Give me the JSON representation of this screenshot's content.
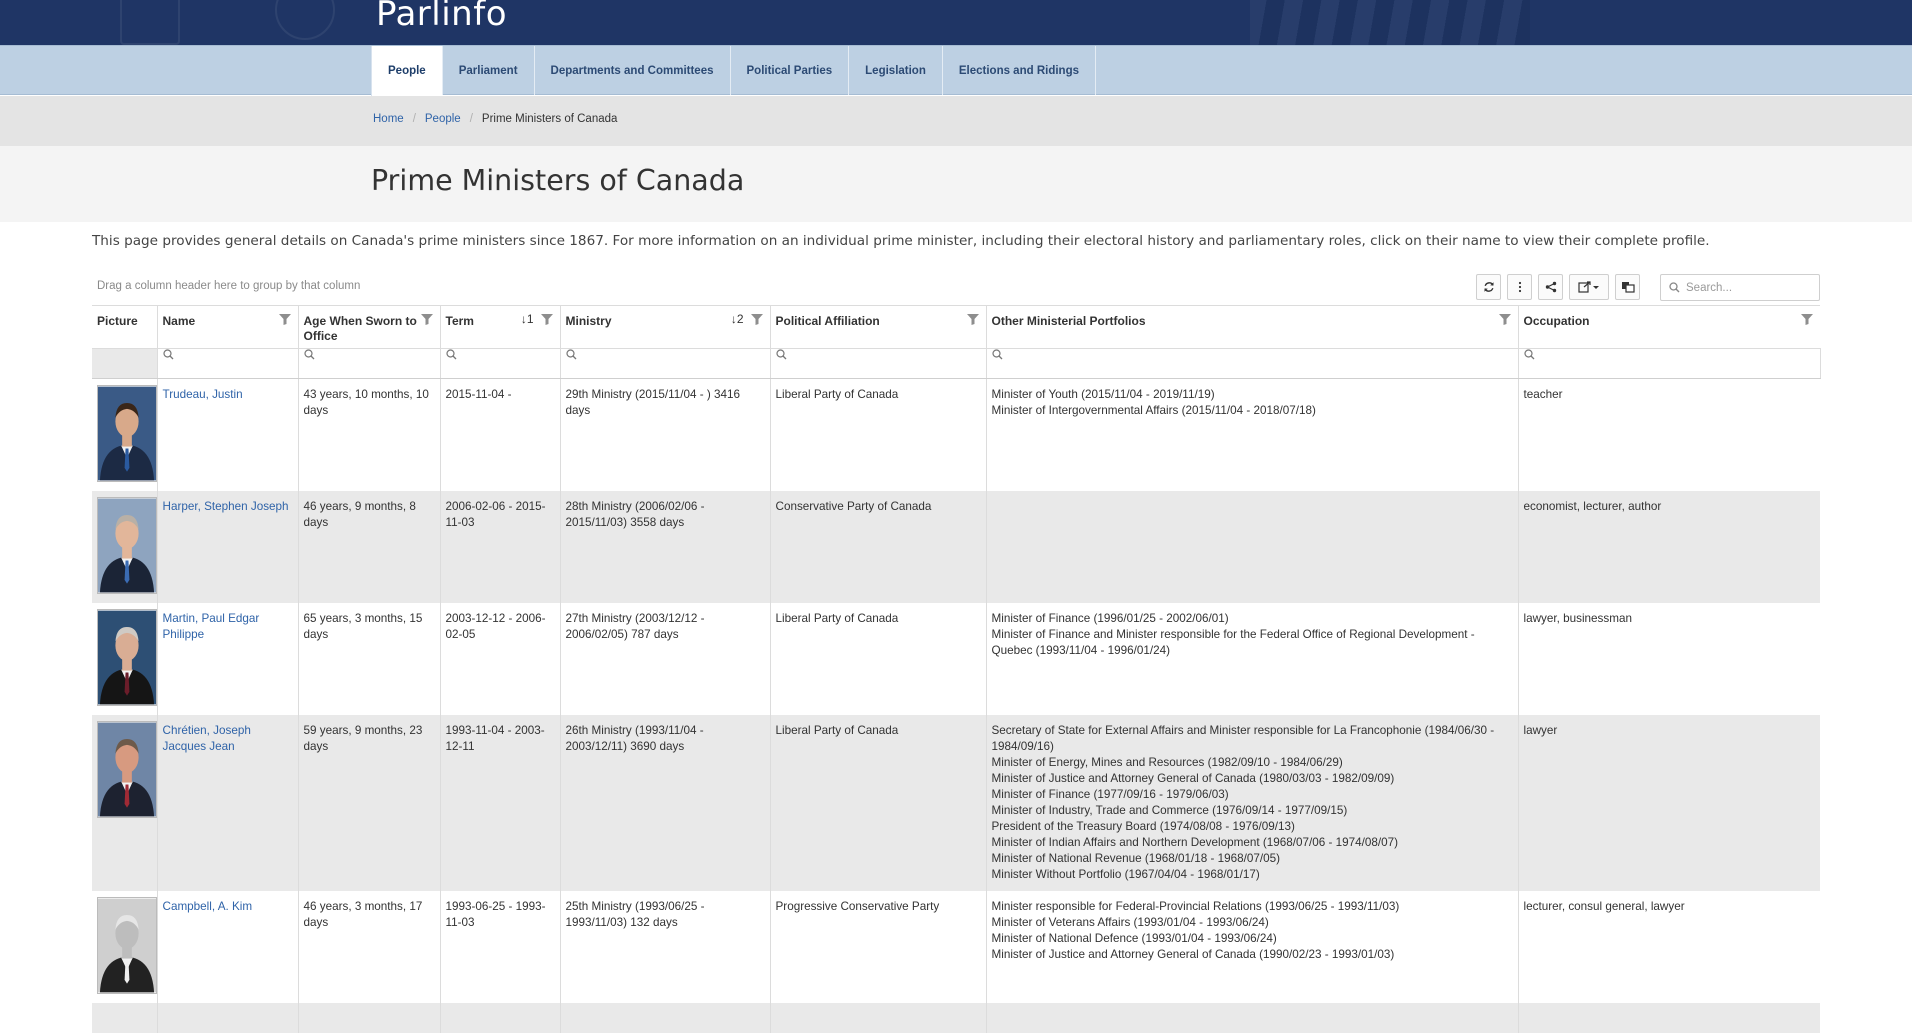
{
  "site": {
    "title": "Parlinfo"
  },
  "nav": {
    "tabs": [
      {
        "label": "People",
        "active": true
      },
      {
        "label": "Parliament"
      },
      {
        "label": "Departments and Committees"
      },
      {
        "label": "Political Parties"
      },
      {
        "label": "Legislation"
      },
      {
        "label": "Elections and Ridings"
      }
    ]
  },
  "breadcrumb": {
    "home": "Home",
    "people": "People",
    "current": "Prime Ministers of Canada"
  },
  "page": {
    "title": "Prime Ministers of Canada",
    "intro": "This page provides general details on Canada's prime ministers since 1867. For more information on an individual prime minister, including their electoral history and parliamentary roles, click on their name to view their complete profile."
  },
  "grid": {
    "group_hint": "Drag a column header here to group by that column",
    "search_placeholder": "Search...",
    "toolbar_icons": [
      "refresh-icon",
      "column-chooser-icon",
      "share-icon",
      "export-icon",
      "language-icon"
    ],
    "columns": [
      {
        "key": "picture",
        "label": "Picture"
      },
      {
        "key": "name",
        "label": "Name"
      },
      {
        "key": "age",
        "label": "Age When Sworn to Office"
      },
      {
        "key": "term",
        "label": "Term",
        "sort": "1"
      },
      {
        "key": "ministry",
        "label": "Ministry",
        "sort": "2"
      },
      {
        "key": "party",
        "label": "Political Affiliation"
      },
      {
        "key": "portfolios",
        "label": "Other Ministerial Portfolios"
      },
      {
        "key": "occupation",
        "label": "Occupation"
      }
    ],
    "rows": [
      {
        "name": "Trudeau, Justin",
        "age": "43 years, 10 months, 10 days",
        "term": "2015-11-04 -",
        "ministry": "29th Ministry (2015/11/04 - ) 3416 days",
        "party": "Liberal Party of Canada",
        "portfolios": [
          "Minister of Youth (2015/11/04 - 2019/11/19)",
          "Minister of Intergovernmental Affairs (2015/11/04 - 2018/07/18)"
        ],
        "occupation": "teacher",
        "portrait": {
          "bg": "#3a5a86",
          "suit": "#1c2a44",
          "skin": "#d8a98a",
          "hair": "#3a2618",
          "tie": "#2a5aa0"
        }
      },
      {
        "name": "Harper, Stephen Joseph",
        "age": "46 years, 9 months, 8 days",
        "term": "2006-02-06 - 2015-11-03",
        "ministry": "28th Ministry (2006/02/06 - 2015/11/03) 3558 days",
        "party": "Conservative Party of Canada",
        "portfolios": [],
        "occupation": "economist, lecturer, author",
        "portrait": {
          "bg": "#8ea4bf",
          "suit": "#1b2436",
          "skin": "#e2b69a",
          "hair": "#b9b0a6",
          "tie": "#3b6cb4"
        }
      },
      {
        "name": "Martin, Paul Edgar Philippe",
        "age": "65 years, 3 months, 15 days",
        "term": "2003-12-12 - 2006-02-05",
        "ministry": "27th Ministry (2003/12/12 - 2006/02/05) 787 days",
        "party": "Liberal Party of Canada",
        "portfolios": [
          "Minister of Finance (1996/01/25 - 2002/06/01)",
          "Minister of Finance and Minister responsible for the Federal Office of Regional Development - Quebec (1993/11/04 - 1996/01/24)"
        ],
        "occupation": "lawyer, businessman",
        "portrait": {
          "bg": "#2d4f74",
          "suit": "#151515",
          "skin": "#d9ad94",
          "hair": "#cfcac4",
          "tie": "#6b1d2a"
        }
      },
      {
        "name": "Chrétien, Joseph Jacques Jean",
        "age": "59 years, 9 months, 23 days",
        "term": "1993-11-04 - 2003-12-11",
        "ministry": "26th Ministry (1993/11/04 - 2003/12/11) 3690 days",
        "party": "Liberal Party of Canada",
        "portfolios": [
          "Secretary of State for External Affairs and Minister responsible for La Francophonie (1984/06/30 - 1984/09/16)",
          "Minister of Energy, Mines and Resources (1982/09/10 - 1984/06/29)",
          "Minister of Justice and Attorney General of Canada (1980/03/03 - 1982/09/09)",
          "Minister of Finance (1977/09/16 - 1979/06/03)",
          "Minister of Industry, Trade and Commerce (1976/09/14 - 1977/09/15)",
          "President of the Treasury Board (1974/08/08 - 1976/09/13)",
          "Minister of Indian Affairs and Northern Development (1968/07/06 - 1974/08/07)",
          "Minister of National Revenue (1968/01/18 - 1968/07/05)",
          "Minister Without Portfolio (1967/04/04 - 1968/01/17)"
        ],
        "occupation": "lawyer",
        "portrait": {
          "bg": "#6f86a6",
          "suit": "#1d2230",
          "skin": "#d79a80",
          "hair": "#6d5a4a",
          "tie": "#a02a35"
        }
      },
      {
        "name": "Campbell, A. Kim",
        "age": "46 years, 3 months, 17 days",
        "term": "1993-06-25 - 1993-11-03",
        "ministry": "25th Ministry (1993/06/25 - 1993/11/03) 132 days",
        "party": "Progressive Conservative Party",
        "portfolios": [
          "Minister responsible for Federal-Provincial Relations (1993/06/25 - 1993/11/03)",
          "Minister of Veterans Affairs (1993/01/04 - 1993/06/24)",
          "Minister of National Defence (1993/01/04 - 1993/06/24)",
          "Minister of Justice and Attorney General of Canada (1990/02/23 - 1993/01/03)"
        ],
        "occupation": "lecturer, consul general, lawyer",
        "portrait": {
          "bg": "#cfcfcf",
          "suit": "#222222",
          "skin": "#bdbdbd",
          "hair": "#e6e6e6",
          "tie": "#f0f0f0"
        }
      }
    ]
  }
}
